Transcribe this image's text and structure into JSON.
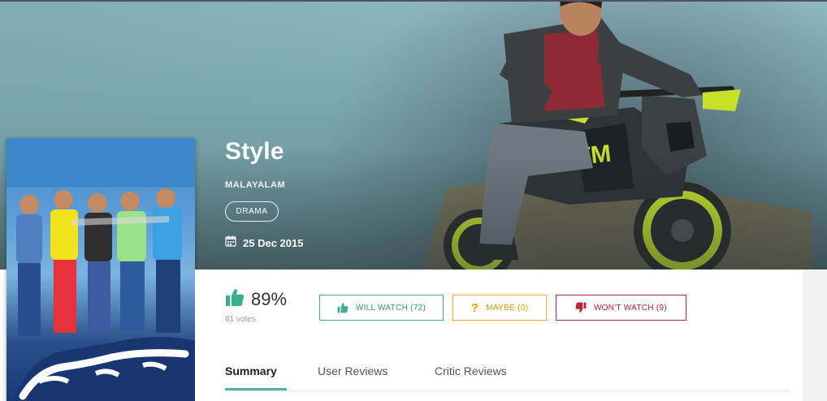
{
  "movie": {
    "title": "Style",
    "language": "MALAYALAM",
    "genre": "DRAMA",
    "release_date": "25 Dec 2015"
  },
  "rating": {
    "value": "89%",
    "votes": "81 votes"
  },
  "actions": {
    "will_watch": "WILL WATCH (72)",
    "maybe": "MAYBE (0)",
    "wont_watch": "WON'T WATCH (9)"
  },
  "tabs": [
    {
      "label": "Summary",
      "active": true
    },
    {
      "label": "User Reviews",
      "active": false
    },
    {
      "label": "Critic Reviews",
      "active": false
    }
  ],
  "icons": {
    "rating": "thumbs-up-icon",
    "date": "calendar-icon",
    "will_watch": "thumbs-up-icon",
    "maybe": "question-mark-icon",
    "wont_watch": "thumbs-down-icon"
  },
  "colors": {
    "accent_green": "#3cb08f",
    "maybe_amber": "#e8b322",
    "wont_red": "#b8233c",
    "tab_underline": "#4fb596"
  }
}
